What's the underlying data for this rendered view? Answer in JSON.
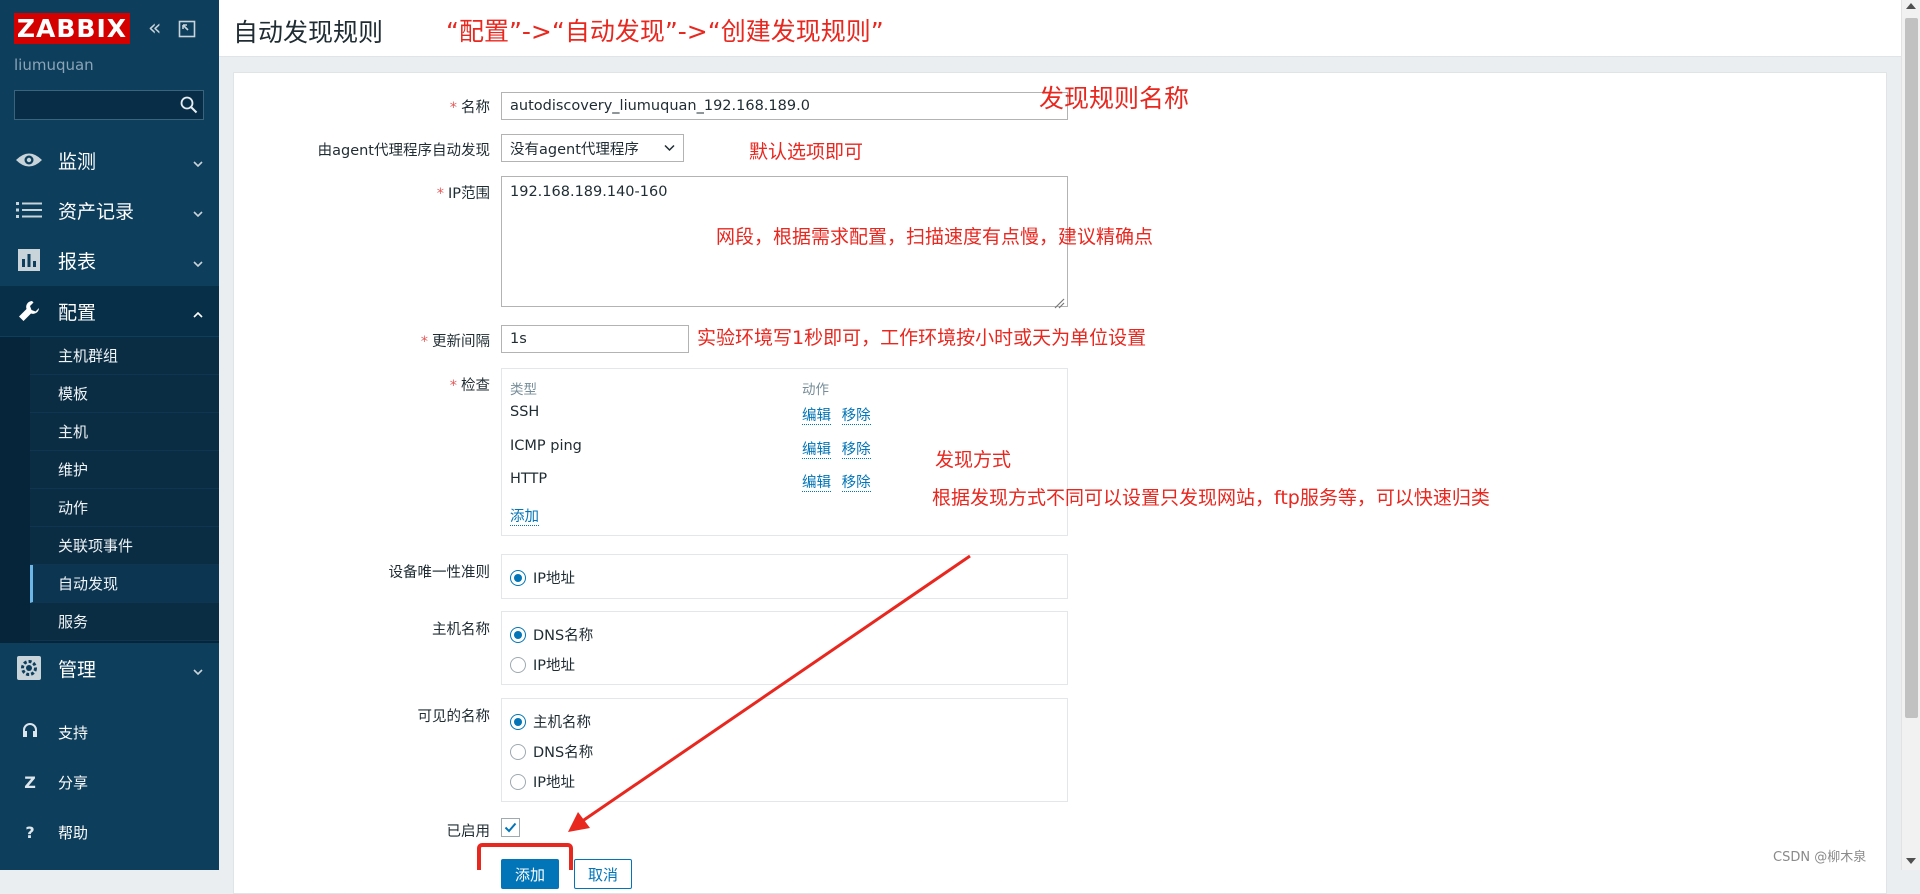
{
  "sidebar": {
    "logo": "ZABBIX",
    "username": "liumuquan",
    "search_placeholder": "",
    "menu": [
      {
        "label": "监测",
        "icon": "eye-icon",
        "expanded": false
      },
      {
        "label": "资产记录",
        "icon": "list-icon",
        "expanded": false
      },
      {
        "label": "报表",
        "icon": "bar-chart-icon",
        "expanded": false
      },
      {
        "label": "配置",
        "icon": "wrench-icon",
        "expanded": true
      },
      {
        "label": "管理",
        "icon": "gear-icon",
        "expanded": false
      }
    ],
    "config_submenu": [
      {
        "label": "主机群组",
        "active": false
      },
      {
        "label": "模板",
        "active": false
      },
      {
        "label": "主机",
        "active": false
      },
      {
        "label": "维护",
        "active": false
      },
      {
        "label": "动作",
        "active": false
      },
      {
        "label": "关联项事件",
        "active": false
      },
      {
        "label": "自动发现",
        "active": true
      },
      {
        "label": "服务",
        "active": false
      }
    ],
    "bottom": [
      {
        "label": "支持",
        "icon": "headset-icon"
      },
      {
        "label": "分享",
        "icon": "share-icon",
        "glyph": "Z"
      },
      {
        "label": "帮助",
        "icon": "help-icon",
        "glyph": "?"
      }
    ]
  },
  "header": {
    "title": "自动发现规则"
  },
  "form": {
    "name_label": "名称",
    "name_value": "autodiscovery_liumuquan_192.168.189.0",
    "proxy_label": "由agent代理程序自动发现",
    "proxy_value": "没有agent代理程序",
    "ip_range_label": "IP范围",
    "ip_range_value": "192.168.189.140-160",
    "interval_label": "更新间隔",
    "interval_value": "1s",
    "checks_label": "检查",
    "checks_header_type": "类型",
    "checks_header_action": "动作",
    "checks": [
      {
        "type": "SSH",
        "edit": "编辑",
        "remove": "移除"
      },
      {
        "type": "ICMP ping",
        "edit": "编辑",
        "remove": "移除"
      },
      {
        "type": "HTTP",
        "edit": "编辑",
        "remove": "移除"
      }
    ],
    "checks_add": "添加",
    "uniqueness_label": "设备唯一性准则",
    "uniqueness_options": [
      {
        "label": "IP地址",
        "selected": true
      }
    ],
    "hostname_label": "主机名称",
    "hostname_options": [
      {
        "label": "DNS名称",
        "selected": true
      },
      {
        "label": "IP地址",
        "selected": false
      }
    ],
    "visible_label": "可见的名称",
    "visible_options": [
      {
        "label": "主机名称",
        "selected": true
      },
      {
        "label": "DNS名称",
        "selected": false
      },
      {
        "label": "IP地址",
        "selected": false
      }
    ],
    "enabled_label": "已启用",
    "enabled": true,
    "add_button": "添加",
    "cancel_button": "取消"
  },
  "annotations": {
    "path": "“配置”->“自动发现”->“创建发现规则”",
    "rule_name": "发现规则名称",
    "default_option": "默认选项即可",
    "ip_range": "网段，根据需求配置，扫描速度有点慢，建议精确点",
    "interval": "实验环境写1秒即可，工作环境按小时或天为单位设置",
    "method_title": "发现方式",
    "method_desc": "根据发现方式不同可以设置只发现网站，ftp服务等，可以快速归类",
    "color": "#e8271f"
  },
  "watermark": "CSDN @柳木泉",
  "colors": {
    "sidebar_bg": "#0d3e5c",
    "logo_red": "#d40000",
    "link_blue": "#0275b8",
    "annotation_red": "#e8271f"
  }
}
